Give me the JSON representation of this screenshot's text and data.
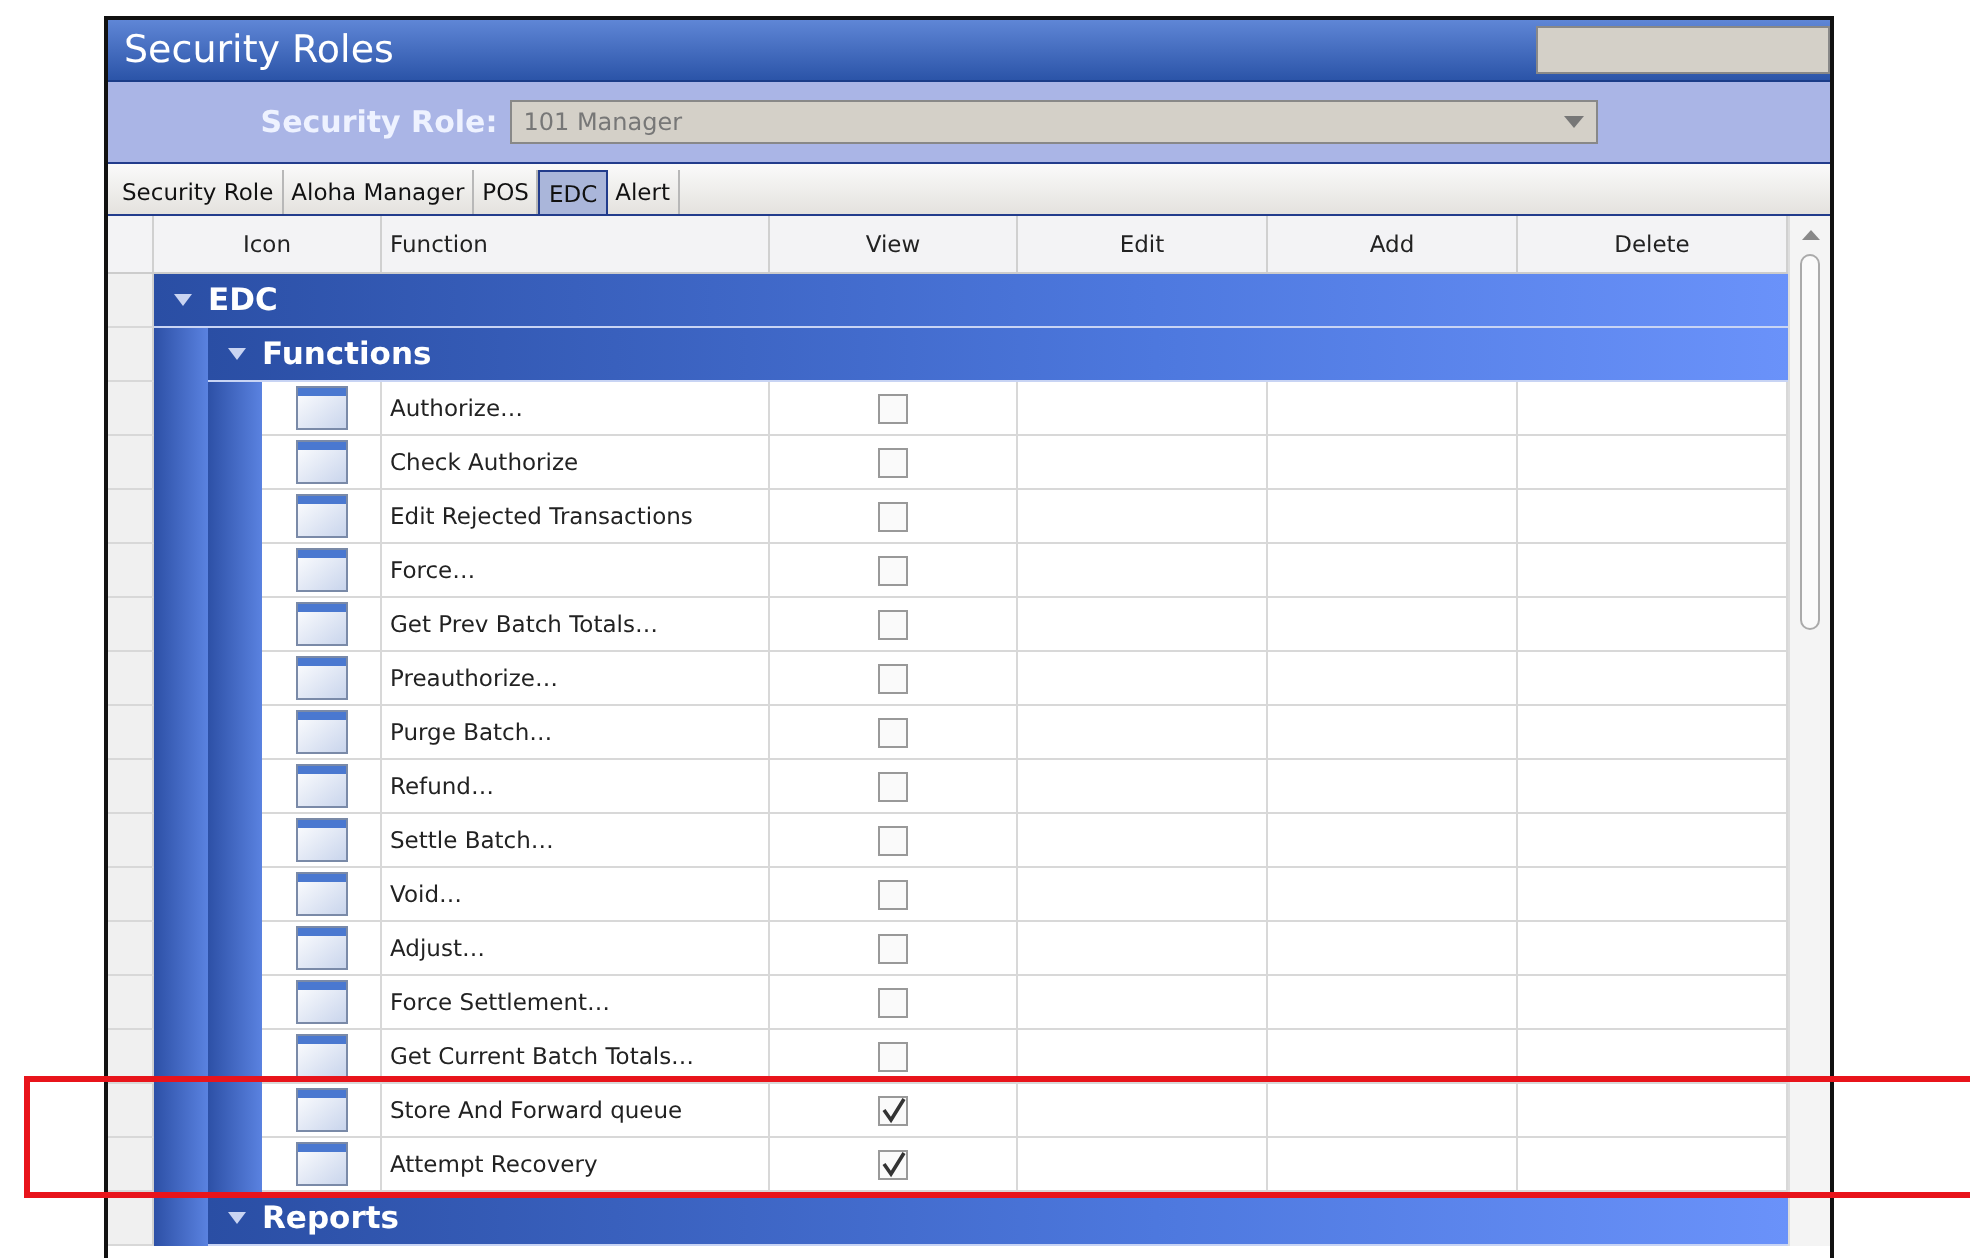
{
  "window": {
    "title": "Security Roles"
  },
  "role_selector": {
    "label": "Security Role:",
    "value": "101 Manager"
  },
  "tabs": [
    {
      "label": "Security Role",
      "selected": false
    },
    {
      "label": "Aloha Manager",
      "selected": false
    },
    {
      "label": "POS",
      "selected": false
    },
    {
      "label": "EDC",
      "selected": true
    },
    {
      "label": "Alert",
      "selected": false
    }
  ],
  "table": {
    "columns": [
      "Icon",
      "Function",
      "View",
      "Edit",
      "Add",
      "Delete"
    ],
    "groups": [
      {
        "name": "EDC",
        "expanded": true,
        "children": [
          {
            "name": "Functions",
            "expanded": true,
            "rows": [
              {
                "function": "Authorize…",
                "view": false,
                "highlighted": false
              },
              {
                "function": "Check Authorize",
                "view": false,
                "highlighted": false
              },
              {
                "function": "Edit Rejected Transactions",
                "view": false,
                "highlighted": false
              },
              {
                "function": "Force…",
                "view": false,
                "highlighted": false
              },
              {
                "function": "Get Prev Batch Totals…",
                "view": false,
                "highlighted": false
              },
              {
                "function": "Preauthorize…",
                "view": false,
                "highlighted": false
              },
              {
                "function": "Purge Batch…",
                "view": false,
                "highlighted": false
              },
              {
                "function": "Refund…",
                "view": false,
                "highlighted": false
              },
              {
                "function": "Settle Batch…",
                "view": false,
                "highlighted": false
              },
              {
                "function": "Void…",
                "view": false,
                "highlighted": false
              },
              {
                "function": "Adjust…",
                "view": false,
                "highlighted": false
              },
              {
                "function": "Force Settlement…",
                "view": false,
                "highlighted": false
              },
              {
                "function": "Get Current Batch Totals…",
                "view": false,
                "highlighted": false
              },
              {
                "function": "Store And Forward queue",
                "view": true,
                "highlighted": true
              },
              {
                "function": "Attempt Recovery",
                "view": true,
                "highlighted": true
              }
            ]
          },
          {
            "name": "Reports",
            "expanded": true
          }
        ]
      }
    ]
  }
}
